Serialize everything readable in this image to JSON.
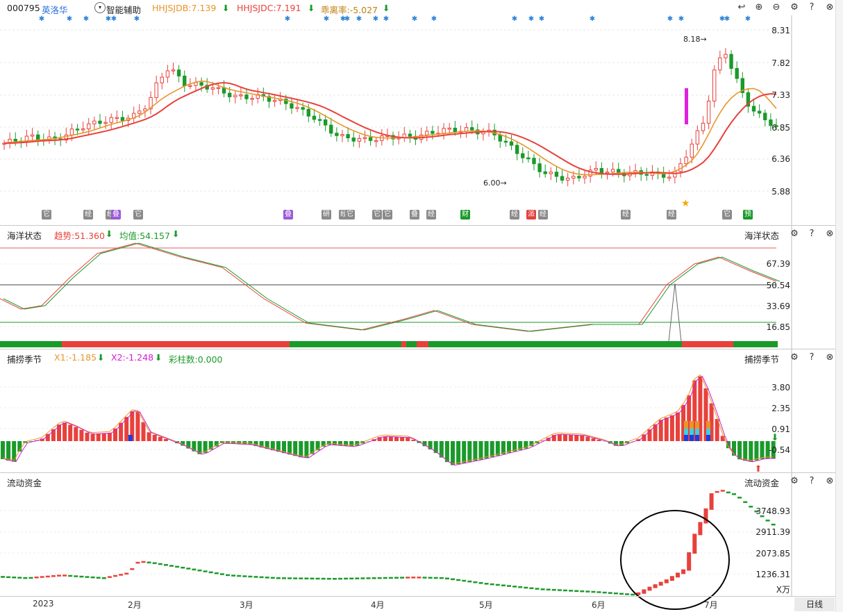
{
  "header": {
    "code": "000795",
    "name": "英洛华",
    "assist": "智能辅助",
    "ind1": "HHJSJDB:7.139",
    "ind2": "HHJSJDC:7.191",
    "ind3": "乖离率:-5.027",
    "arrow_down": "⬇"
  },
  "price_axis": [
    "8.31",
    "7.82",
    "7.33",
    "6.85",
    "6.36",
    "5.88"
  ],
  "annotations": {
    "high": "8.18→",
    "low": "6.00→"
  },
  "event_tags": [
    {
      "t": "它",
      "c": "gray"
    },
    {
      "t": "经",
      "c": "gray"
    },
    {
      "t": "经",
      "c": "gray"
    },
    {
      "t": "叠",
      "c": "purple"
    },
    {
      "t": "它",
      "c": "gray"
    },
    {
      "t": "叠",
      "c": "purple"
    },
    {
      "t": "研",
      "c": "gray"
    },
    {
      "t": "经",
      "c": "gray"
    },
    {
      "t": "它",
      "c": "gray"
    },
    {
      "t": "它",
      "c": "gray"
    },
    {
      "t": "它",
      "c": "gray"
    },
    {
      "t": "叠",
      "c": "gray"
    },
    {
      "t": "经",
      "c": "gray"
    },
    {
      "t": "财",
      "c": "green"
    },
    {
      "t": "经",
      "c": "gray"
    },
    {
      "t": "派",
      "c": "red"
    },
    {
      "t": "经",
      "c": "gray"
    },
    {
      "t": "经",
      "c": "gray"
    },
    {
      "t": "经",
      "c": "gray"
    },
    {
      "t": "它",
      "c": "gray"
    },
    {
      "t": "预",
      "c": "green"
    }
  ],
  "panel2": {
    "title": "海洋状态",
    "trend": "趋势:51.360",
    "avg": "均值:54.157",
    "right_title": "海洋状态",
    "axis": [
      "67.39",
      "50.54",
      "33.69",
      "16.85"
    ]
  },
  "panel3": {
    "title": "捕捞季节",
    "x1": "X1:-1.185",
    "x2": "X2:-1.248",
    "cai": "彩柱数:0.000",
    "right_title": "捕捞季节",
    "axis": [
      "3.80",
      "2.35",
      "0.91",
      "-0.54"
    ]
  },
  "panel4": {
    "title": "流动资金",
    "right_title": "流动资金",
    "axis": [
      "3748.93",
      "2911.39",
      "2073.85",
      "1236.31"
    ],
    "unit": "X万"
  },
  "months": [
    "2023",
    "2月",
    "3月",
    "4月",
    "5月",
    "6月",
    "7月"
  ],
  "period": "日线",
  "colors": {
    "up": "#e8413c",
    "down": "#1a9a2a",
    "ma_orange": "#e8952a",
    "ma_red": "#e8413c",
    "magenta": "#e020e0"
  }
}
